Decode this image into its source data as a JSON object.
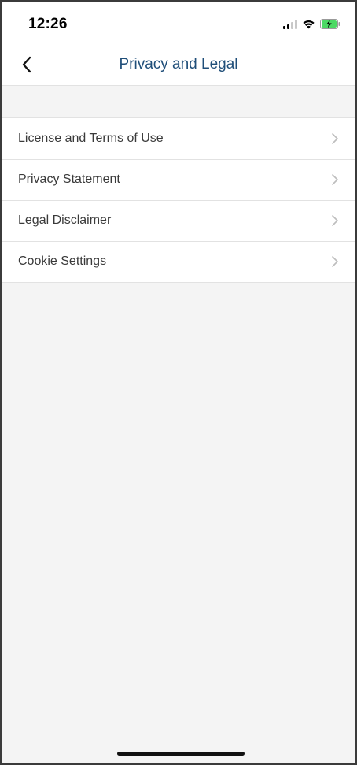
{
  "status_bar": {
    "time": "12:26",
    "icons": [
      "signal-icon",
      "wifi-icon",
      "battery-charging-icon"
    ],
    "battery_color": "#4cd964"
  },
  "nav": {
    "back_icon": "chevron-left-icon",
    "title": "Privacy and Legal",
    "title_color": "#1f4e79"
  },
  "list": {
    "items": [
      {
        "label": "License and Terms of Use"
      },
      {
        "label": "Privacy Statement"
      },
      {
        "label": "Legal Disclaimer"
      },
      {
        "label": "Cookie Settings"
      }
    ]
  }
}
